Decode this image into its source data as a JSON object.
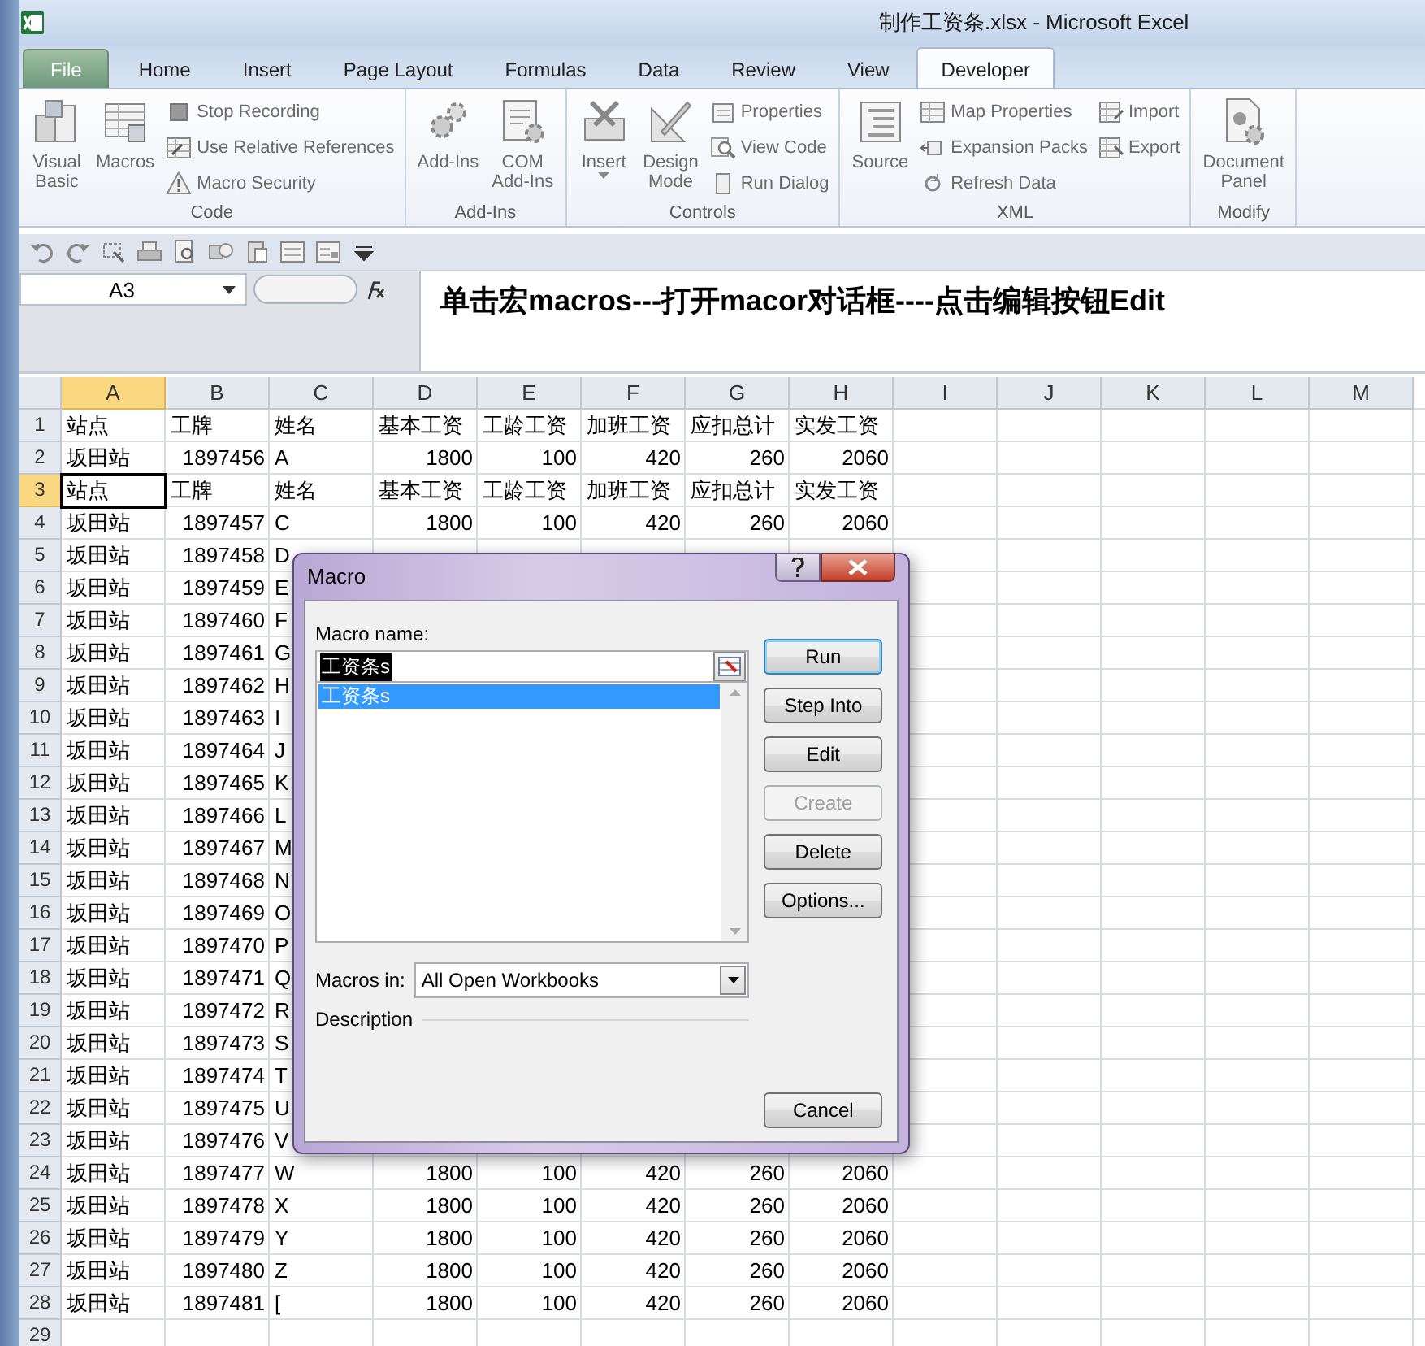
{
  "window": {
    "title": "制作工资条.xlsx - Microsoft Excel"
  },
  "tabs": [
    {
      "label": "File",
      "kind": "file",
      "selected": false
    },
    {
      "label": "Home",
      "kind": "tab",
      "selected": false
    },
    {
      "label": "Insert",
      "kind": "tab",
      "selected": false
    },
    {
      "label": "Page Layout",
      "kind": "tab",
      "selected": false
    },
    {
      "label": "Formulas",
      "kind": "tab",
      "selected": false
    },
    {
      "label": "Data",
      "kind": "tab",
      "selected": false
    },
    {
      "label": "Review",
      "kind": "tab",
      "selected": false
    },
    {
      "label": "View",
      "kind": "tab",
      "selected": false
    },
    {
      "label": "Developer",
      "kind": "tab",
      "selected": true
    }
  ],
  "ribbon": {
    "groups": [
      {
        "label": "Code",
        "items": [
          {
            "kind": "large",
            "label": "Visual\nBasic"
          },
          {
            "kind": "large",
            "label": "Macros"
          },
          {
            "kind": "stack",
            "items": [
              {
                "label": "Stop Recording"
              },
              {
                "label": "Use Relative References"
              },
              {
                "label": "Macro Security"
              }
            ]
          }
        ]
      },
      {
        "label": "Add-Ins",
        "items": [
          {
            "kind": "large",
            "label": "Add-Ins"
          },
          {
            "kind": "large",
            "label": "COM\nAdd-Ins"
          }
        ]
      },
      {
        "label": "Controls",
        "items": [
          {
            "kind": "large",
            "label": "Insert",
            "dropdown": true
          },
          {
            "kind": "large",
            "label": "Design\nMode"
          },
          {
            "kind": "stack",
            "items": [
              {
                "label": "Properties"
              },
              {
                "label": "View Code"
              },
              {
                "label": "Run Dialog"
              }
            ]
          }
        ]
      },
      {
        "label": "XML",
        "items": [
          {
            "kind": "large",
            "label": "Source"
          },
          {
            "kind": "stack",
            "items": [
              {
                "label": "Map Properties"
              },
              {
                "label": "Expansion Packs"
              },
              {
                "label": "Refresh Data"
              }
            ]
          },
          {
            "kind": "stack",
            "items": [
              {
                "label": "Import"
              },
              {
                "label": "Export"
              }
            ]
          }
        ]
      },
      {
        "label": "Modify",
        "items": [
          {
            "kind": "large",
            "label": "Document\nPanel"
          }
        ]
      }
    ]
  },
  "formula_bar": {
    "name_box": "A3",
    "formula": "单击宏macros---打开macor对话框----点击编辑按钮Edit"
  },
  "sheet": {
    "columns": [
      {
        "label": "A",
        "selected": true
      },
      {
        "label": "B",
        "selected": false
      },
      {
        "label": "C",
        "selected": false
      },
      {
        "label": "D",
        "selected": false
      },
      {
        "label": "E",
        "selected": false
      },
      {
        "label": "F",
        "selected": false
      },
      {
        "label": "G",
        "selected": false
      },
      {
        "label": "H",
        "selected": false
      },
      {
        "label": "I",
        "selected": false
      },
      {
        "label": "J",
        "selected": false
      },
      {
        "label": "K",
        "selected": false
      },
      {
        "label": "L",
        "selected": false
      },
      {
        "label": "M",
        "selected": false
      }
    ],
    "rows": [
      {
        "header": "1",
        "kind": "header",
        "selected": false,
        "cells": [
          "站点",
          "工牌",
          "姓名",
          "基本工资",
          "工龄工资",
          "加班工资",
          "应扣总计",
          "实发工资"
        ]
      },
      {
        "header": "2",
        "kind": "data",
        "selected": false,
        "cells": [
          "坂田站",
          "1897456",
          "A",
          "1800",
          "100",
          "420",
          "260",
          "2060"
        ]
      },
      {
        "header": "3",
        "kind": "header",
        "selected": true,
        "cells": [
          "站点",
          "工牌",
          "姓名",
          "基本工资",
          "工龄工资",
          "加班工资",
          "应扣总计",
          "实发工资"
        ]
      },
      {
        "header": "4",
        "kind": "data",
        "selected": false,
        "cells": [
          "坂田站",
          "1897457",
          "C",
          "1800",
          "100",
          "420",
          "260",
          "2060"
        ]
      },
      {
        "header": "5",
        "kind": "data",
        "selected": false,
        "cells": [
          "坂田站",
          "1897458",
          "D"
        ]
      },
      {
        "header": "6",
        "kind": "data",
        "selected": false,
        "cells": [
          "坂田站",
          "1897459",
          "E"
        ]
      },
      {
        "header": "7",
        "kind": "data",
        "selected": false,
        "cells": [
          "坂田站",
          "1897460",
          "F"
        ]
      },
      {
        "header": "8",
        "kind": "data",
        "selected": false,
        "cells": [
          "坂田站",
          "1897461",
          "G"
        ]
      },
      {
        "header": "9",
        "kind": "data",
        "selected": false,
        "cells": [
          "坂田站",
          "1897462",
          "H"
        ]
      },
      {
        "header": "10",
        "kind": "data",
        "selected": false,
        "cells": [
          "坂田站",
          "1897463",
          "I"
        ]
      },
      {
        "header": "11",
        "kind": "data",
        "selected": false,
        "cells": [
          "坂田站",
          "1897464",
          "J"
        ]
      },
      {
        "header": "12",
        "kind": "data",
        "selected": false,
        "cells": [
          "坂田站",
          "1897465",
          "K"
        ]
      },
      {
        "header": "13",
        "kind": "data",
        "selected": false,
        "cells": [
          "坂田站",
          "1897466",
          "L"
        ]
      },
      {
        "header": "14",
        "kind": "data",
        "selected": false,
        "cells": [
          "坂田站",
          "1897467",
          "M"
        ]
      },
      {
        "header": "15",
        "kind": "data",
        "selected": false,
        "cells": [
          "坂田站",
          "1897468",
          "N"
        ]
      },
      {
        "header": "16",
        "kind": "data",
        "selected": false,
        "cells": [
          "坂田站",
          "1897469",
          "O"
        ]
      },
      {
        "header": "17",
        "kind": "data",
        "selected": false,
        "cells": [
          "坂田站",
          "1897470",
          "P"
        ]
      },
      {
        "header": "18",
        "kind": "data",
        "selected": false,
        "cells": [
          "坂田站",
          "1897471",
          "Q"
        ]
      },
      {
        "header": "19",
        "kind": "data",
        "selected": false,
        "cells": [
          "坂田站",
          "1897472",
          "R"
        ]
      },
      {
        "header": "20",
        "kind": "data",
        "selected": false,
        "cells": [
          "坂田站",
          "1897473",
          "S"
        ]
      },
      {
        "header": "21",
        "kind": "data",
        "selected": false,
        "cells": [
          "坂田站",
          "1897474",
          "T"
        ]
      },
      {
        "header": "22",
        "kind": "data",
        "selected": false,
        "cells": [
          "坂田站",
          "1897475",
          "U"
        ]
      },
      {
        "header": "23",
        "kind": "data",
        "selected": false,
        "cells": [
          "坂田站",
          "1897476",
          "V"
        ]
      },
      {
        "header": "24",
        "kind": "data",
        "selected": false,
        "cells": [
          "坂田站",
          "1897477",
          "W",
          "1800",
          "100",
          "420",
          "260",
          "2060"
        ]
      },
      {
        "header": "25",
        "kind": "data",
        "selected": false,
        "cells": [
          "坂田站",
          "1897478",
          "X",
          "1800",
          "100",
          "420",
          "260",
          "2060"
        ]
      },
      {
        "header": "26",
        "kind": "data",
        "selected": false,
        "cells": [
          "坂田站",
          "1897479",
          "Y",
          "1800",
          "100",
          "420",
          "260",
          "2060"
        ]
      },
      {
        "header": "27",
        "kind": "data",
        "selected": false,
        "cells": [
          "坂田站",
          "1897480",
          "Z",
          "1800",
          "100",
          "420",
          "260",
          "2060"
        ]
      },
      {
        "header": "28",
        "kind": "data",
        "selected": false,
        "cells": [
          "坂田站",
          "1897481",
          "[",
          "1800",
          "100",
          "420",
          "260",
          "2060"
        ]
      },
      {
        "header": "29",
        "kind": "data",
        "selected": false,
        "cells": []
      }
    ]
  },
  "dialog": {
    "title": "Macro",
    "name_label": "Macro name:",
    "name_field": {
      "value": "工资条s",
      "selected": true
    },
    "macros": [
      {
        "label": "工资条s",
        "selected": true
      }
    ],
    "buttons": [
      {
        "label": "Run",
        "default": true,
        "disabled": false
      },
      {
        "label": "Step Into",
        "default": false,
        "disabled": false
      },
      {
        "label": "Edit",
        "default": false,
        "disabled": false
      },
      {
        "label": "Create",
        "default": false,
        "disabled": true
      },
      {
        "label": "Delete",
        "default": false,
        "disabled": false
      },
      {
        "label": "Options...",
        "default": false,
        "disabled": false
      }
    ],
    "macros_in_label": "Macros in:",
    "macros_in_value": "All Open Workbooks",
    "description_label": "Description",
    "cancel": "Cancel"
  }
}
